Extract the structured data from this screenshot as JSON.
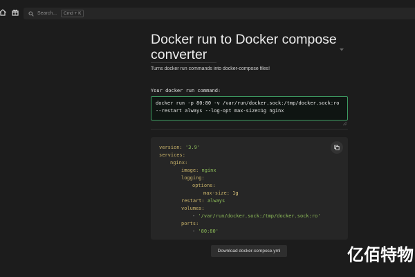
{
  "topbar": {
    "home_icon": "home-icon",
    "gift_icon": "gift-icon",
    "search_placeholder": "Search...",
    "search_shortcut": "Cmd + K"
  },
  "main": {
    "title": "Docker run to Docker compose converter",
    "subtitle": "Turns docker run commands into docker-compose files!",
    "input_label": "Your docker run command:",
    "input_value": "docker run -p 80:80 -v /var/run/docker.sock:/tmp/docker.sock:ro --restart always --log-opt max-size=1g nginx",
    "download_label": "Download docker-compose.yml"
  },
  "yaml": {
    "version_key": "version:",
    "version_val": "'3.9'",
    "services_key": "services:",
    "nginx_key": "nginx:",
    "image_key": "image:",
    "image_val": "nginx",
    "logging_key": "logging:",
    "options_key": "options:",
    "maxsize_key": "max-size:",
    "maxsize_val": "1g",
    "restart_key": "restart:",
    "restart_val": "always",
    "volumes_key": "volumes:",
    "volume_item": "'/var/run/docker.sock:/tmp/docker.sock:ro'",
    "ports_key": "ports:",
    "port_item": "'80:80'",
    "dash": "-"
  },
  "watermark": "亿佰特物"
}
